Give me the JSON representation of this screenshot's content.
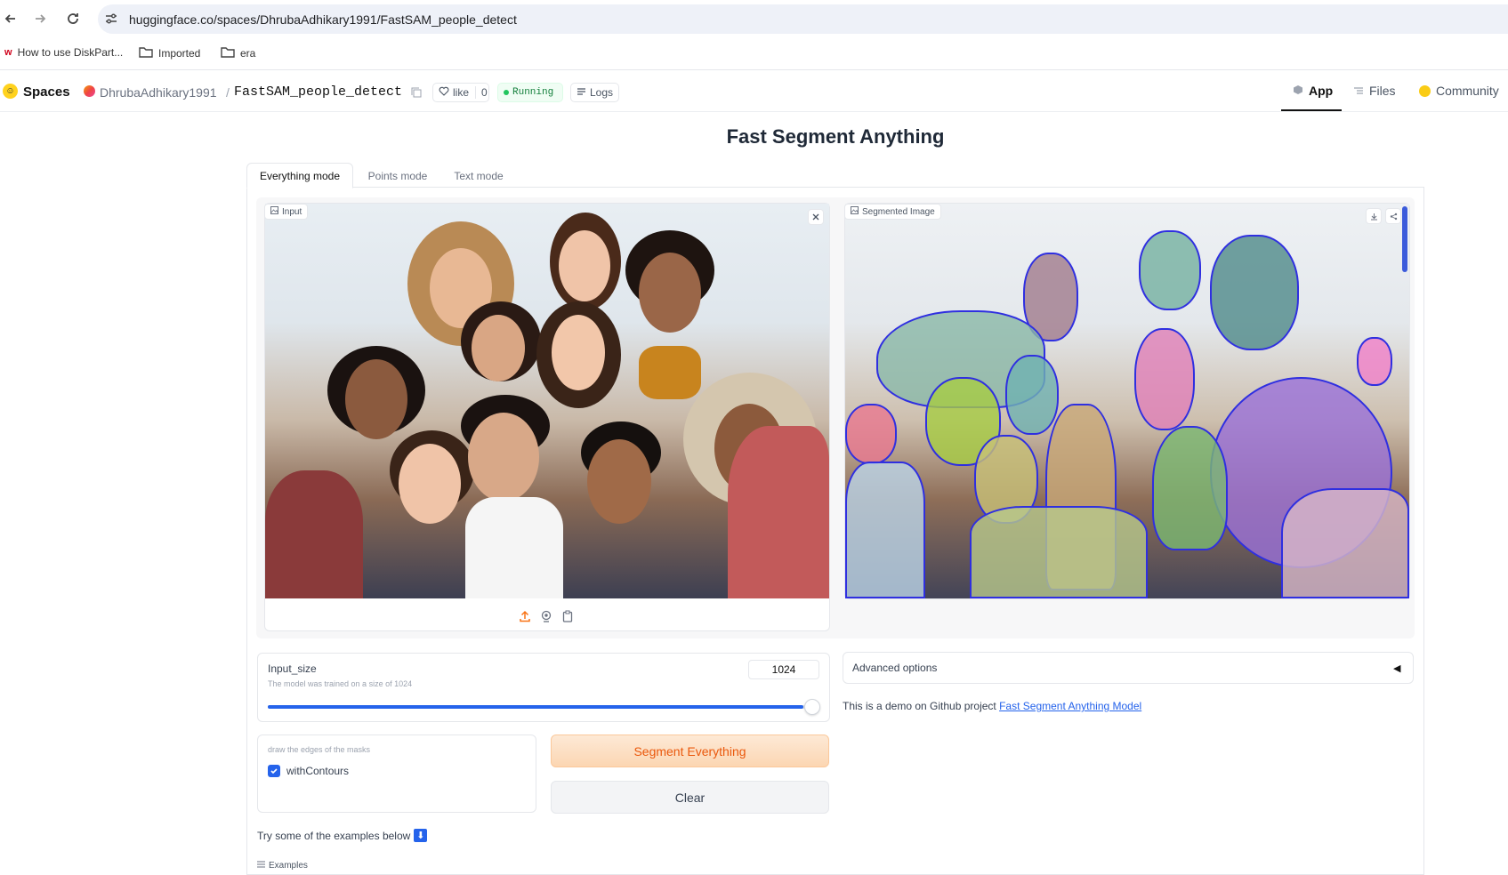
{
  "browser": {
    "url": "huggingface.co/spaces/DhrubaAdhikary1991/FastSAM_people_detect",
    "bookmarks": [
      "How to use DiskPart...",
      "Imported",
      "era"
    ]
  },
  "hf_header": {
    "spaces_label": "Spaces",
    "owner": "DhrubaAdhikary1991",
    "separator": "/",
    "space_name": "FastSAM_people_detect",
    "like_label": "like",
    "like_count": "0",
    "status": "Running",
    "logs_label": "Logs",
    "nav": {
      "app": "App",
      "files": "Files",
      "community": "Community"
    }
  },
  "app": {
    "title": "Fast Segment Anything",
    "tabs": [
      "Everything mode",
      "Points mode",
      "Text mode"
    ],
    "active_tab": "Everything mode",
    "input_label": "Input",
    "output_label": "Segmented Image",
    "input_size": {
      "label": "Input_size",
      "info": "The model was trained on a size of 1024",
      "value": "1024",
      "fraction": 1.0
    },
    "advanced_options": "Advanced options",
    "demo_text": "This is a demo on Github project ",
    "demo_link": "Fast Segment Anything Model",
    "contours": {
      "info": "draw the edges of the masks",
      "label": "withContours",
      "checked": true
    },
    "segment_button": "Segment Everything",
    "clear_button": "Clear",
    "examples_intro": "Try some of the examples below",
    "examples_label": "Examples"
  },
  "colors": {
    "accent_orange": "#f97316",
    "segment_bg": "#fde6cf",
    "slider_blue": "#2563eb",
    "running_green": "#16a34a",
    "contour_blue": "#2f2fe0"
  }
}
